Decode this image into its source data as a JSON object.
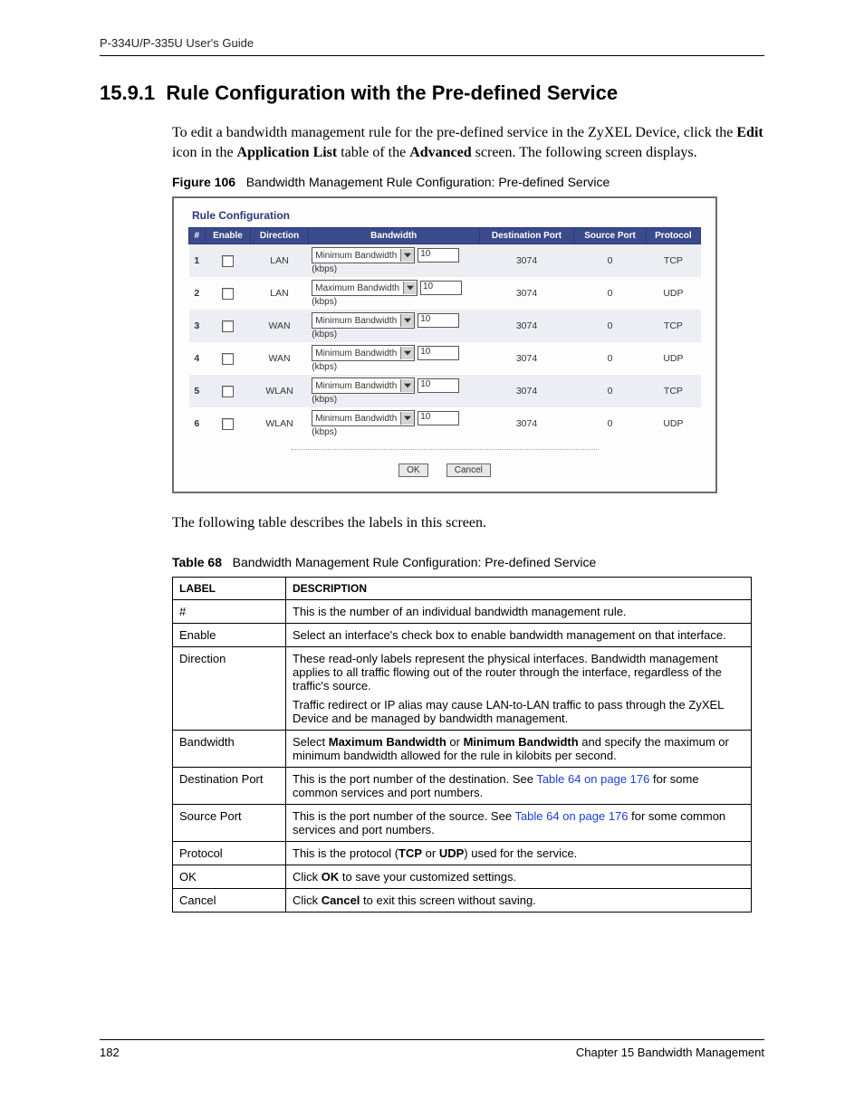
{
  "header": {
    "guide_title": "P-334U/P-335U User's Guide"
  },
  "section": {
    "number": "15.9.1",
    "title": "Rule Configuration with the Pre-defined Service"
  },
  "intro_paragraph": {
    "part1": "To edit a bandwidth management rule for the pre-defined service in the ZyXEL Device, click the ",
    "bold1": "Edit",
    "mid1": " icon in the ",
    "bold2": "Application List",
    "mid2": " table of the ",
    "bold3": "Advanced",
    "end": " screen. The following screen displays."
  },
  "figure": {
    "label": "Figure 106",
    "caption": "Bandwidth Management Rule Configuration: Pre-defined Service",
    "panel_title": "Rule Configuration",
    "columns": [
      "#",
      "Enable",
      "Direction",
      "Bandwidth",
      "Destination Port",
      "Source Port",
      "Protocol"
    ],
    "rows": [
      {
        "n": "1",
        "dir": "LAN",
        "bw_mode": "Minimum Bandwidth",
        "bw_val": "10",
        "unit": "(kbps)",
        "dport": "3074",
        "sport": "0",
        "proto": "TCP"
      },
      {
        "n": "2",
        "dir": "LAN",
        "bw_mode": "Maximum Bandwidth",
        "bw_val": "10",
        "unit": "(kbps)",
        "dport": "3074",
        "sport": "0",
        "proto": "UDP"
      },
      {
        "n": "3",
        "dir": "WAN",
        "bw_mode": "Minimum Bandwidth",
        "bw_val": "10",
        "unit": "(kbps)",
        "dport": "3074",
        "sport": "0",
        "proto": "TCP"
      },
      {
        "n": "4",
        "dir": "WAN",
        "bw_mode": "Minimum Bandwidth",
        "bw_val": "10",
        "unit": "(kbps)",
        "dport": "3074",
        "sport": "0",
        "proto": "UDP"
      },
      {
        "n": "5",
        "dir": "WLAN",
        "bw_mode": "Minimum Bandwidth",
        "bw_val": "10",
        "unit": "(kbps)",
        "dport": "3074",
        "sport": "0",
        "proto": "TCP"
      },
      {
        "n": "6",
        "dir": "WLAN",
        "bw_mode": "Minimum Bandwidth",
        "bw_val": "10",
        "unit": "(kbps)",
        "dport": "3074",
        "sport": "0",
        "proto": "UDP"
      }
    ],
    "ok_label": "OK",
    "cancel_label": "Cancel"
  },
  "mid_paragraph": "The following table describes the labels in this screen.",
  "table": {
    "label": "Table 68",
    "caption": "Bandwidth Management Rule Configuration: Pre-defined Service",
    "head_label": "LABEL",
    "head_desc": "DESCRIPTION",
    "link_text": "Table 64 on page 176",
    "rows": [
      {
        "label": "#",
        "desc_plain": "This is the number of an individual bandwidth management rule."
      },
      {
        "label": "Enable",
        "desc_plain": "Select an interface's check box to enable bandwidth management on that interface."
      },
      {
        "label": "Direction",
        "desc_para1": "These read-only labels represent the physical interfaces. Bandwidth management applies to all traffic flowing out of the router through the interface, regardless of the traffic's source.",
        "desc_para2": "Traffic redirect or IP alias may cause LAN-to-LAN traffic to pass through the ZyXEL Device and be managed by bandwidth management."
      },
      {
        "label": "Bandwidth",
        "desc_pre": "Select ",
        "desc_b1": "Maximum Bandwidth",
        "desc_mid": " or ",
        "desc_b2": "Minimum Bandwidth",
        "desc_post": " and specify the maximum or minimum bandwidth allowed for the rule in kilobits per second."
      },
      {
        "label": "Destination Port",
        "desc_pre": "This is the port number of the destination. See ",
        "desc_link": true,
        "desc_post": " for some common services and port numbers."
      },
      {
        "label": "Source Port",
        "desc_pre": "This is the port number of the source. See ",
        "desc_link": true,
        "desc_post": " for some common services and port numbers."
      },
      {
        "label": "Protocol",
        "desc_pre": "This is the protocol (",
        "desc_b1": "TCP",
        "desc_mid": " or ",
        "desc_b2": "UDP",
        "desc_post": ") used for the service."
      },
      {
        "label": "OK",
        "desc_pre": "Click ",
        "desc_b1": "OK",
        "desc_post": " to save your customized settings."
      },
      {
        "label": "Cancel",
        "desc_pre": "Click ",
        "desc_b1": "Cancel",
        "desc_post": " to exit this screen without saving."
      }
    ]
  },
  "footer": {
    "page_number": "182",
    "chapter": "Chapter 15 Bandwidth Management"
  }
}
